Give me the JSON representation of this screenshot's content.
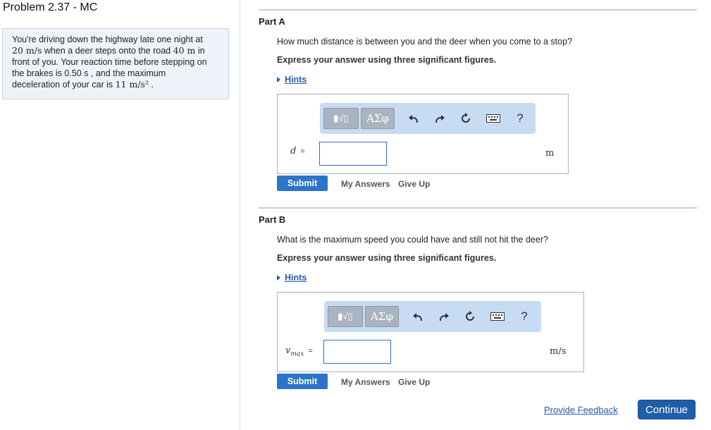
{
  "problem": {
    "title": "Problem 2.37 - MC",
    "text_1": "You're driving down the highway late one night at",
    "text_2_speed": "20 m/s",
    "text_2_rest": " when a deer steps onto the road ",
    "text_2_dist": "40 m",
    "text_2_end": " in",
    "text_3": "front of you. Your reaction time before stepping on",
    "text_4_a": "the brakes is ",
    "text_4_time": "0.50 s",
    "text_4_b": " , and the maximum",
    "text_5_a": "deceleration of your car is ",
    "text_5_accel": "11 m/s²",
    "text_5_b": " ."
  },
  "toolbar": {
    "template_label": "▮√▯",
    "greek_label": "ΑΣφ",
    "undo_icon": "undo-icon",
    "redo_icon": "redo-icon",
    "reset_icon": "reset-icon",
    "keyboard_icon": "keyboard-icon",
    "help_label": "?"
  },
  "part_a": {
    "label": "Part A",
    "question": "How much distance is between you and the deer when you come to a stop?",
    "express": "Express your answer using three significant figures.",
    "hints": "Hints",
    "variable": "d",
    "equals": "=",
    "value": "",
    "unit": "m",
    "submit": "Submit",
    "my_answers": "My Answers",
    "give_up": "Give Up"
  },
  "part_b": {
    "label": "Part B",
    "question": "What is the maximum speed you could have and still not hit the deer?",
    "express": "Express your answer using three significant figures.",
    "hints": "Hints",
    "variable": "v",
    "subscript": "max",
    "equals": "=",
    "value": "",
    "unit": "m/s",
    "submit": "Submit",
    "my_answers": "My Answers",
    "give_up": "Give Up"
  },
  "footer": {
    "feedback": "Provide Feedback",
    "continue": "Continue"
  },
  "colors": {
    "accent": "#2b74c9",
    "toolbar_bg": "#c7dcf3",
    "problem_bg": "#eef3f9"
  }
}
